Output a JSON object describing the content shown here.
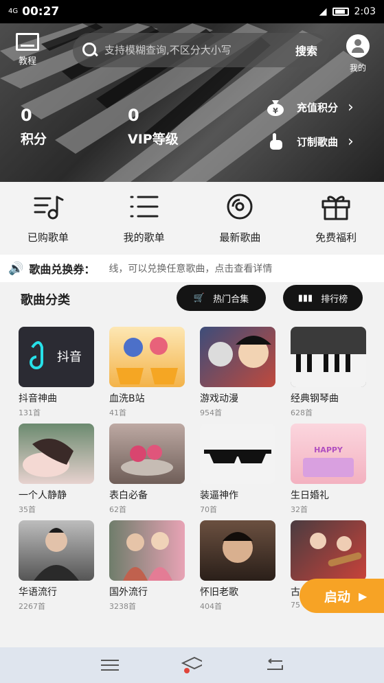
{
  "status_bar": {
    "network": "4G",
    "time_left": "00:27",
    "time_right": "2:03"
  },
  "header": {
    "tutorial_label": "教程",
    "search_placeholder": "支持模糊查询,不区分大小写",
    "search_button": "搜索",
    "mine_label": "我的",
    "points_value": "0",
    "points_label": "积分",
    "vip_value": "0",
    "vip_label": "VIP等级",
    "recharge_label": "充值积分",
    "custom_label": "订制歌曲"
  },
  "quick_menu": [
    {
      "label": "已购歌单",
      "icon": "music-list-icon"
    },
    {
      "label": "我的歌单",
      "icon": "list-icon"
    },
    {
      "label": "最新歌曲",
      "icon": "disc-icon"
    },
    {
      "label": "免费福利",
      "icon": "gift-icon"
    }
  ],
  "coupon": {
    "title": "歌曲兑换券：",
    "text": "线，可以兑换任意歌曲，点击查看详情"
  },
  "categories": {
    "title": "歌曲分类",
    "hot_button": "热门合集",
    "rank_button": "排行榜",
    "items": [
      {
        "name": "抖音神曲",
        "count": "131首",
        "color": "#2b2b33"
      },
      {
        "name": "血洗B站",
        "count": "41首",
        "color": "#f3c26a"
      },
      {
        "name": "游戏动漫",
        "count": "954首",
        "color": "#c04a3d"
      },
      {
        "name": "经典钢琴曲",
        "count": "628首",
        "color": "#555555"
      },
      {
        "name": "一个人静静",
        "count": "35首",
        "color": "#d8b4b0"
      },
      {
        "name": "表白必备",
        "count": "62首",
        "color": "#9c7f7a"
      },
      {
        "name": "装逼神作",
        "count": "70首",
        "color": "#f1f1f1"
      },
      {
        "name": "生日婚礼",
        "count": "32首",
        "color": "#f7c5cf"
      },
      {
        "name": "华语流行",
        "count": "2267首",
        "color": "#3a3a3a"
      },
      {
        "name": "国外流行",
        "count": "3238首",
        "color": "#e39aa8"
      },
      {
        "name": "怀旧老歌",
        "count": "404首",
        "color": "#4b3a30"
      },
      {
        "name": "古",
        "count": "75",
        "color": "#c9423a"
      }
    ]
  },
  "launch_button": "启动",
  "nav": {
    "menu_icon": "menu-icon",
    "home_icon": "home-icon",
    "back_icon": "back-icon"
  },
  "colors": {
    "accent": "#f7a325",
    "pill_bg": "#141414",
    "nav_bg": "#dfe5ee"
  }
}
